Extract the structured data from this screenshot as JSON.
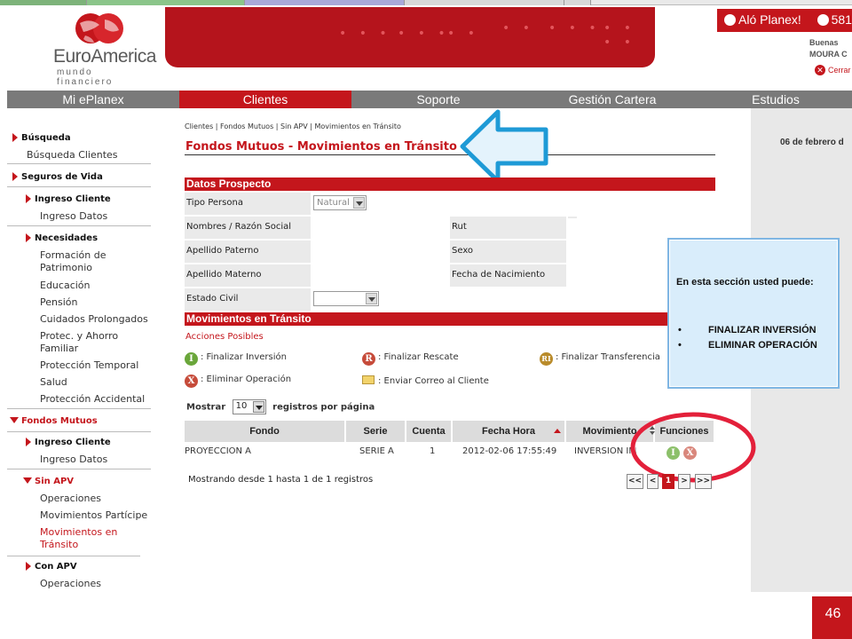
{
  "brand": {
    "logo_name": "EuroAmerica",
    "logo_sub": "mundo financiero",
    "accent_color": "#c4161c"
  },
  "header": {
    "alo_label": "Aló Planex!",
    "phone": "581",
    "greet_line1": "Buenas",
    "greet_line2": "MOURA C",
    "logout_label": "Cerrar"
  },
  "nav": {
    "items": [
      {
        "label": "Mi ePlanex"
      },
      {
        "label": "Clientes"
      },
      {
        "label": "Soporte"
      },
      {
        "label": "Gestión Cartera"
      },
      {
        "label": "Estudios"
      }
    ],
    "active_index": 1
  },
  "right_panel": {
    "date": "06 de febrero d"
  },
  "sidebar": {
    "busqueda": "Búsqueda",
    "busqueda_clientes": "Búsqueda Clientes",
    "seguros_vida": "Seguros de Vida",
    "ingreso_cliente_1": "Ingreso Cliente",
    "ingreso_datos_1": "Ingreso Datos",
    "necesidades": "Necesidades",
    "formacion": "Formación de Patrimonio",
    "educacion": "Educación",
    "pension": "Pensión",
    "cuidados": "Cuidados Prolongados",
    "protec_ahorro": "Protec. y Ahorro Familiar",
    "proteccion_temporal": "Protección Temporal",
    "salud": "Salud",
    "proteccion_accidental": "Protección Accidental",
    "fondos_mutuos": "Fondos Mutuos",
    "ingreso_cliente_2": "Ingreso Cliente",
    "ingreso_datos_2": "Ingreso Datos",
    "sin_apv": "Sin APV",
    "operaciones_1": "Operaciones",
    "mov_participe": "Movimientos Partícipe",
    "mov_transito": "Movimientos en Tránsito",
    "con_apv": "Con APV",
    "operaciones_2": "Operaciones"
  },
  "main": {
    "breadcrumb": "Clientes | Fondos Mutuos | Sin APV | Movimientos en Tránsito",
    "title": "Fondos Mutuos - Movimientos en Tránsito",
    "datos_prospecto": "Datos Prospecto",
    "fields": {
      "tipo_persona": "Tipo Persona",
      "tipo_persona_value": "Natural",
      "nombres": "Nombres / Razón Social",
      "rut": "Rut",
      "apellido_paterno": "Apellido Paterno",
      "sexo": "Sexo",
      "apellido_materno": "Apellido Materno",
      "fecha_nacimiento": "Fecha de Nacimiento",
      "estado_civil": "Estado Civil"
    },
    "movimientos_transito": "Movimientos en Tránsito",
    "acciones_posibles": "Acciones Posibles",
    "actions": {
      "finalizar_inversion_icon": "I",
      "finalizar_inversion": ": Finalizar Inversión",
      "finalizar_rescate_icon": "R",
      "finalizar_rescate": ": Finalizar Rescate",
      "finalizar_transferencia_icon": "RI",
      "finalizar_transferencia": ": Finalizar Transferencia",
      "eliminar_operacion_icon": "X",
      "eliminar_operacion": ": Eliminar Operación",
      "enviar_correo": ": Enviar Correo al Cliente"
    },
    "mostrar_label": "Mostrar",
    "page_size": "10",
    "registros_label": "registros por página",
    "table": {
      "headers": [
        "Fondo",
        "Serie",
        "Cuenta",
        "Fecha Hora",
        "Movimiento",
        "Funciones"
      ],
      "rows": [
        {
          "fondo": "PROYECCION A",
          "serie": "SERIE A",
          "cuenta": "1",
          "fecha_hora": "2012-02-06 17:55:49",
          "movimiento": "INVERSIÓN INICIA",
          "fn_inv": "I",
          "fn_del": "X"
        }
      ]
    },
    "showing": "Mostrando desde 1 hasta 1 de 1 registros",
    "pager": {
      "first": "<<",
      "prev": "<",
      "current": "1",
      "next": ">",
      "last": ">>"
    }
  },
  "callout": {
    "intro": "En esta sección usted puede:",
    "items": [
      "FINALIZAR INVERSIÓN",
      "ELIMINAR OPERACIÓN"
    ]
  },
  "slide_number": "46"
}
